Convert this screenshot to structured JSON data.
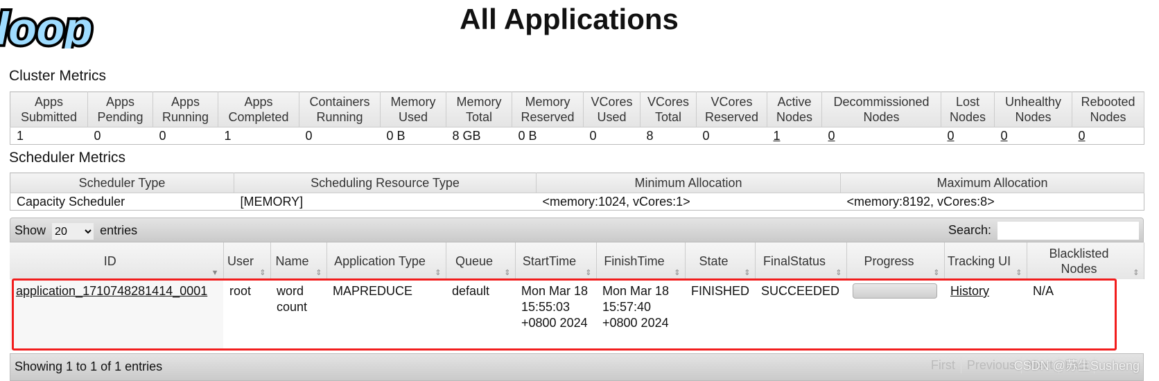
{
  "title": "All Applications",
  "logo_text": "loop",
  "cluster": {
    "heading": "Cluster Metrics",
    "headers": [
      [
        "Apps",
        "Submitted"
      ],
      [
        "Apps",
        "Pending"
      ],
      [
        "Apps",
        "Running"
      ],
      [
        "Apps",
        "Completed"
      ],
      [
        "Containers",
        "Running"
      ],
      [
        "Memory",
        "Used"
      ],
      [
        "Memory",
        "Total"
      ],
      [
        "Memory",
        "Reserved"
      ],
      [
        "VCores",
        "Used"
      ],
      [
        "VCores",
        "Total"
      ],
      [
        "VCores",
        "Reserved"
      ],
      [
        "Active",
        "Nodes"
      ],
      [
        "Decommissioned",
        "Nodes"
      ],
      [
        "Lost",
        "Nodes"
      ],
      [
        "Unhealthy",
        "Nodes"
      ],
      [
        "Rebooted",
        "Nodes"
      ]
    ],
    "values": [
      "1",
      "0",
      "0",
      "1",
      "0",
      "0 B",
      "8 GB",
      "0 B",
      "0",
      "8",
      "0",
      "1",
      "0",
      "0",
      "0",
      "0"
    ]
  },
  "scheduler": {
    "heading": "Scheduler Metrics",
    "headers": [
      "Scheduler Type",
      "Scheduling Resource Type",
      "Minimum Allocation",
      "Maximum Allocation"
    ],
    "values": [
      "Capacity Scheduler",
      "[MEMORY]",
      "<memory:1024, vCores:1>",
      "<memory:8192, vCores:8>"
    ]
  },
  "toolbar": {
    "show": "Show",
    "entries": "entries",
    "page_size": "20",
    "search_label": "Search:",
    "search_value": ""
  },
  "apps": {
    "headers": [
      "ID",
      "User",
      "Name",
      "Application Type",
      "Queue",
      "StartTime",
      "FinishTime",
      "State",
      "FinalStatus",
      "Progress",
      "Tracking UI",
      "Blacklisted Nodes"
    ],
    "row": {
      "id": "application_1710748281414_0001",
      "user": "root",
      "name": "word count",
      "type": "MAPREDUCE",
      "queue": "default",
      "start": "Mon Mar 18 15:55:03 +0800 2024",
      "finish": "Mon Mar 18 15:57:40 +0800 2024",
      "state": "FINISHED",
      "final_status": "SUCCEEDED",
      "progress": 0,
      "tracking": "History",
      "blacklisted": "N/A"
    }
  },
  "footer": {
    "info": "Showing 1 to 1 of 1 entries",
    "first": "First",
    "previous": "Previous",
    "next": "Next",
    "last": "Last"
  },
  "watermark": "CSDN @苏生Susheng",
  "colors": {
    "highlight": "#f21d1d",
    "logo": "#9fdcff"
  }
}
